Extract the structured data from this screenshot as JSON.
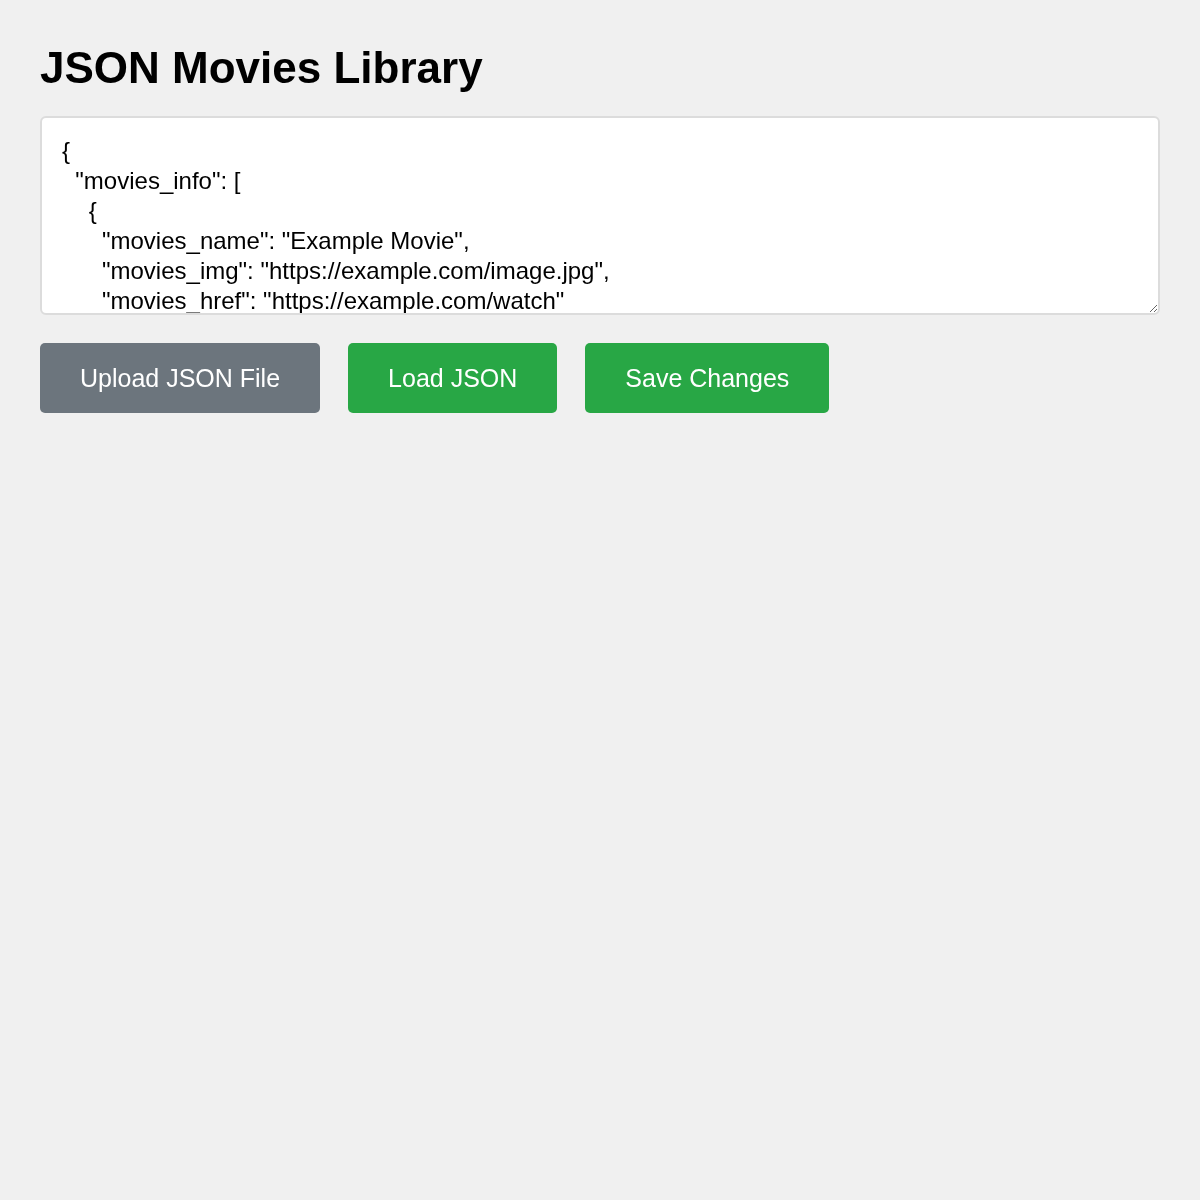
{
  "title": "JSON Movies Library",
  "editor": {
    "value": "{\n  \"movies_info\": [\n    {\n      \"movies_name\": \"Example Movie\",\n      \"movies_img\": \"https://example.com/image.jpg\",\n      \"movies_href\": \"https://example.com/watch\""
  },
  "buttons": [
    {
      "label": "Upload JSON File",
      "kind": "secondary"
    },
    {
      "label": "Load JSON",
      "kind": "primary"
    },
    {
      "label": "Save Changes",
      "kind": "primary"
    }
  ]
}
